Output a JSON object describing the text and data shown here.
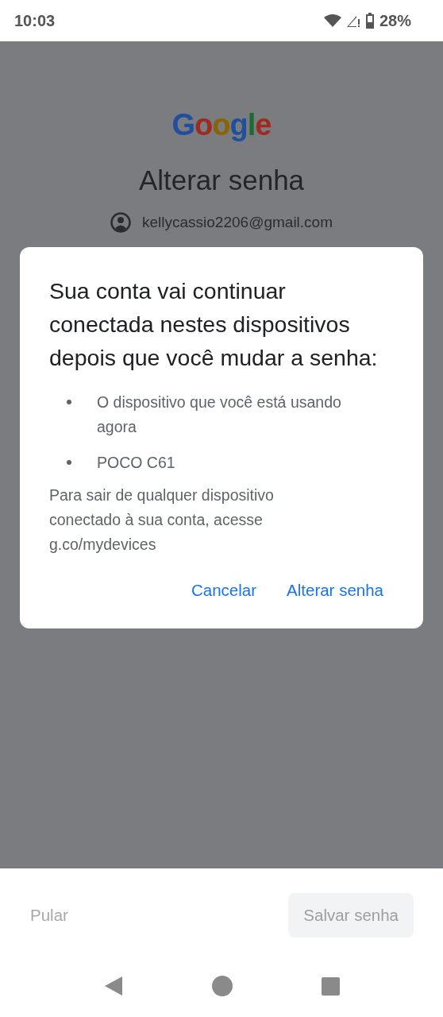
{
  "status_bar": {
    "time": "10:03",
    "battery": "28%"
  },
  "page": {
    "logo": "Google",
    "title": "Alterar senha",
    "account": "kellycassio2206@gmail.com"
  },
  "dialog": {
    "title": "Sua conta vai continuar conectada nestes dispositivos depois que você mudar a senha:",
    "devices": [
      "O dispositivo que você está usando agora",
      "POCO C61"
    ],
    "note": "Para sair de qualquer dispositivo conectado à sua conta, acesse g.co/mydevices",
    "buttons": [
      "Cancelar",
      "Alterar senha"
    ]
  },
  "footer": {
    "buttons": [
      {
        "label": "Pular",
        "kind": "text",
        "disabled": true
      },
      {
        "label": "Salvar senha",
        "kind": "filled",
        "disabled": true
      }
    ]
  }
}
